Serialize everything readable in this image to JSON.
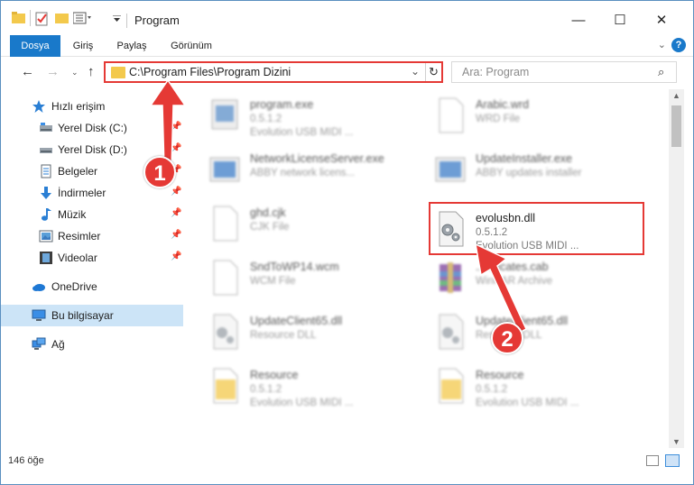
{
  "window": {
    "title": "Program",
    "controls": {
      "minimize": "—",
      "maximize": "☐",
      "close": "✕"
    }
  },
  "ribbon": {
    "tabs": [
      "Dosya",
      "Giriş",
      "Paylaş",
      "Görünüm"
    ],
    "help": "?"
  },
  "navigation": {
    "address": "C:\\Program Files\\Program Dizini",
    "search_placeholder": "Ara: Program"
  },
  "sidebar": {
    "items": [
      {
        "label": "Hızlı erişim",
        "icon": "star-icon",
        "pinned": false
      },
      {
        "label": "Yerel Disk (C:)",
        "icon": "drive-icon",
        "pinned": true
      },
      {
        "label": "Yerel Disk (D:)",
        "icon": "drive-icon",
        "pinned": true
      },
      {
        "label": "Belgeler",
        "icon": "document-icon",
        "pinned": true
      },
      {
        "label": "İndirmeler",
        "icon": "download-icon",
        "pinned": true
      },
      {
        "label": "Müzik",
        "icon": "music-icon",
        "pinned": true
      },
      {
        "label": "Resimler",
        "icon": "pictures-icon",
        "pinned": true
      },
      {
        "label": "Videolar",
        "icon": "video-icon",
        "pinned": true
      },
      {
        "label": "OneDrive",
        "icon": "cloud-icon",
        "pinned": false
      },
      {
        "label": "Bu bilgisayar",
        "icon": "computer-icon",
        "pinned": false,
        "selected": true
      },
      {
        "label": "Ağ",
        "icon": "network-icon",
        "pinned": false
      }
    ]
  },
  "files": [
    {
      "name": "program.exe",
      "line2": "0.5.1.2",
      "line3": "Evolution USB MIDI ...",
      "icon": "exe-icon"
    },
    {
      "name": "Arabic.wrd",
      "line2": "WRD File",
      "line3": "",
      "icon": "blank-file-icon"
    },
    {
      "name": "NetworkLicenseServer.exe",
      "line2": "ABBY network licens...",
      "line3": "",
      "icon": "exe-icon"
    },
    {
      "name": "UpdateInstaller.exe",
      "line2": "ABBY updates installer",
      "line3": "",
      "icon": "exe-icon"
    },
    {
      "name": "ghd.cjk",
      "line2": "CJK File",
      "line3": "",
      "icon": "blank-file-icon"
    },
    {
      "name": "evolusbn.dll",
      "line2": "0.5.1.2",
      "line3": "Evolution USB MIDI ...",
      "icon": "dll-gear-icon"
    },
    {
      "name": "SndToWP14.wcm",
      "line2": "WCM File",
      "line3": "",
      "icon": "blank-file-icon"
    },
    {
      "name": "...rtificates.cab",
      "line2": "WinRAR Archive",
      "line3": "",
      "icon": "archive-icon"
    },
    {
      "name": "UpdateClient65.dll",
      "line2": "Resource DLL",
      "line3": "",
      "icon": "dll-gear-icon"
    },
    {
      "name": "UpdateClient65.dll",
      "line2": "Resource DLL",
      "line3": "",
      "icon": "dll-gear-icon"
    },
    {
      "name": "Resource",
      "line2": "0.5.1.2",
      "line3": "Evolution USB MIDI ...",
      "icon": "folder-file-icon"
    },
    {
      "name": "Resource",
      "line2": "0.5.1.2",
      "line3": "Evolution USB MIDI ...",
      "icon": "folder-file-icon"
    }
  ],
  "status": {
    "count": "146 öğe"
  },
  "annotations": {
    "step1": "1",
    "step2": "2",
    "color": "#e53935"
  }
}
